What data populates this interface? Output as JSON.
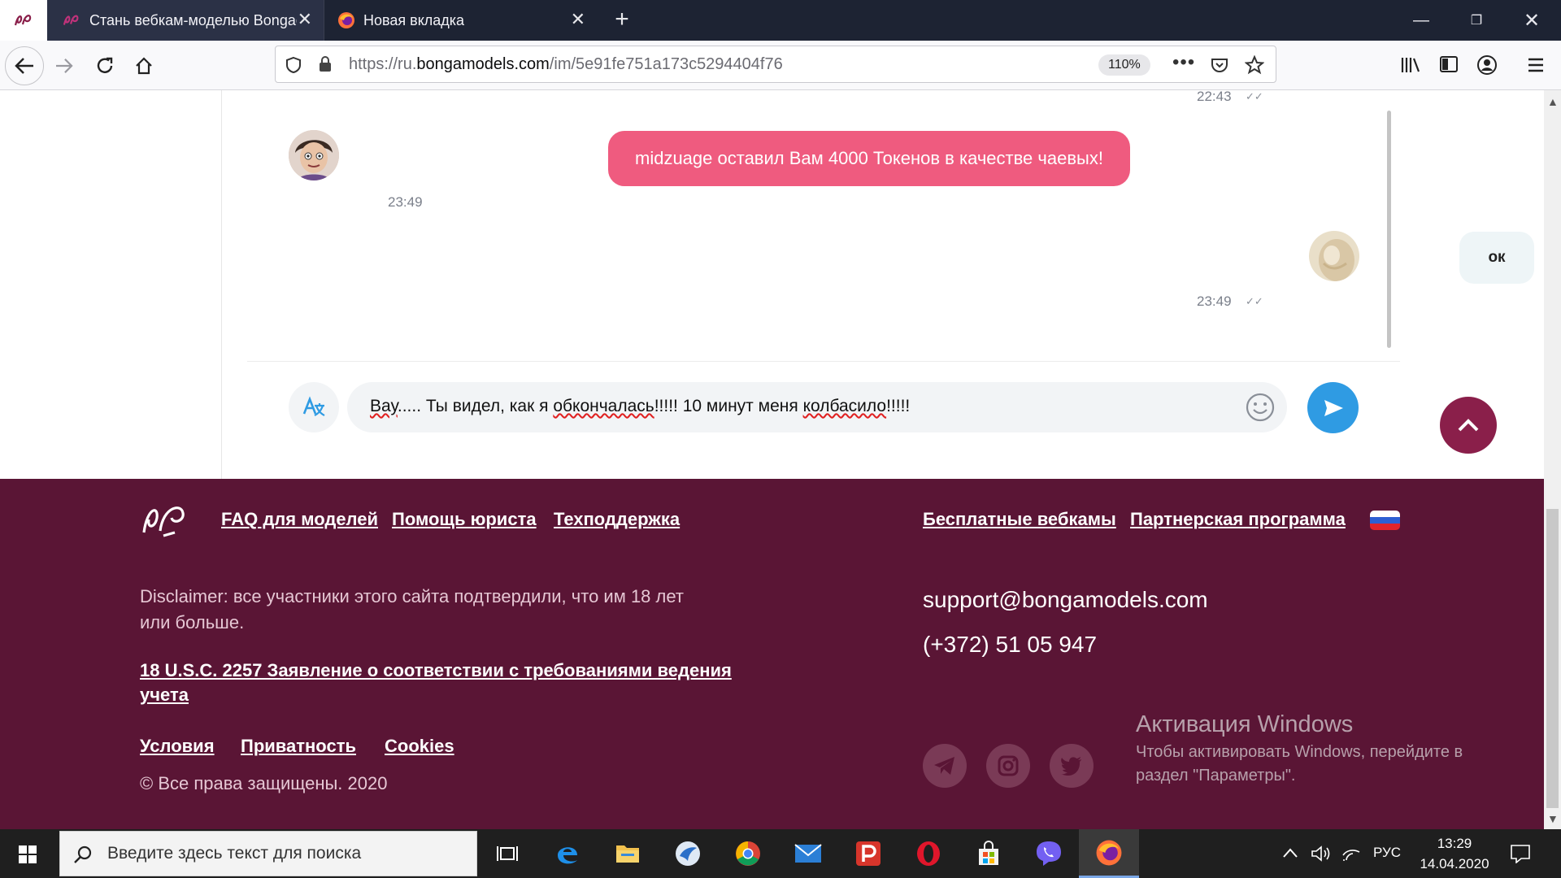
{
  "browser": {
    "tabs": [
      {
        "title": "Стань вебкам-моделью Bongac",
        "active": true
      },
      {
        "title": "Новая вкладка",
        "active": false
      }
    ],
    "url": {
      "prefix": "https://ru.",
      "domain": "bongamodels.com",
      "path": "/im/5e91fe751a173c5294404f76"
    },
    "zoom": "110%"
  },
  "chat": {
    "prev_time": "22:43",
    "tip_message": "midzuage оставил Вам 4000 Токенов в качестве чаевых!",
    "tip_time": "23:49",
    "my_message": "ок",
    "my_time": "23:49",
    "draft": {
      "w1": "Вау",
      "t1": "..... Ты видел, как я ",
      "w2": "обкончалась",
      "t2": "!!!!! 10 минут меня ",
      "w3": "колбасило",
      "t3": "!!!!!"
    }
  },
  "footer": {
    "links_left": [
      "FAQ для моделей",
      "Помощь юриста",
      "Техподдержка"
    ],
    "links_right": [
      "Бесплатные вебкамы",
      "Партнерская программа"
    ],
    "disclaimer_line1": "Disclaimer: все участники этого сайта подтвердили, что им 18 лет",
    "disclaimer_line2": "или больше.",
    "usc_line1": "18 U.S.C. 2257 Заявление о соответствии с требованиями ведения",
    "usc_line2": "учета",
    "legal_links": [
      "Условия",
      "Приватность",
      "Cookies"
    ],
    "copyright": "© Все права защищены. 2020",
    "email": "support@bongamodels.com",
    "phone": "(+372) 51 05 947"
  },
  "activation": {
    "title": "Активация Windows",
    "line1": "Чтобы активировать Windows, перейдите в",
    "line2": "раздел \"Параметры\"."
  },
  "taskbar": {
    "search_placeholder": "Введите здесь текст для поиска",
    "lang": "РУС",
    "time": "13:29",
    "date": "14.04.2020"
  }
}
